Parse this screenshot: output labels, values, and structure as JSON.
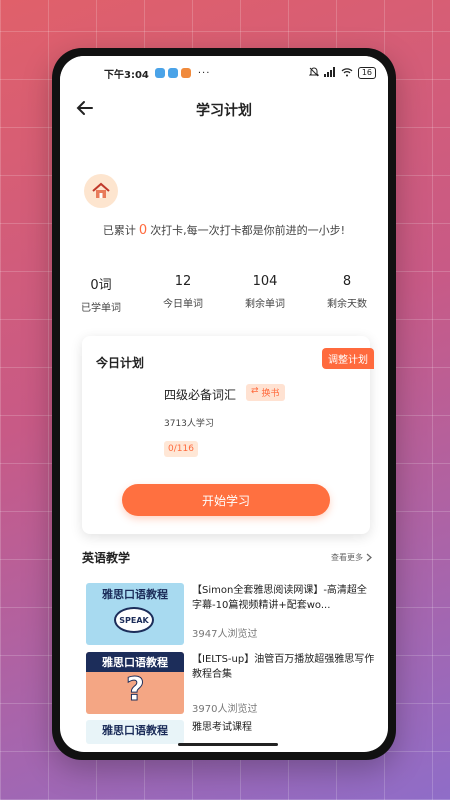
{
  "status_bar": {
    "time": "下午3:04",
    "dots": "···",
    "battery": "16"
  },
  "header": {
    "title": "学习计划"
  },
  "checkin": {
    "prefix": "已累计",
    "count": "0",
    "suffix": "次打卡,每一次打卡都是你前进的一小步!"
  },
  "stats": [
    {
      "value": "0词",
      "label": "已学单词"
    },
    {
      "value": "12",
      "label": "今日单词"
    },
    {
      "value": "104",
      "label": "剩余单词"
    },
    {
      "value": "8",
      "label": "剩余天数"
    }
  ],
  "plan": {
    "title": "今日计划",
    "adjust_label": "调整计划",
    "book_name": "四级必备词汇",
    "swap_label": "换书",
    "learners": "3713人学习",
    "progress": "0/116",
    "start_label": "开始学习"
  },
  "section": {
    "title": "英语教学",
    "see_more": "查看更多"
  },
  "courses": [
    {
      "title": "【Simon全套雅思阅读网课】-高清超全字幕-10篇视频精讲+配套wo...",
      "views": "3947人浏览过",
      "thumb_banner": "雅思口语教程",
      "thumb_badge": "SPEAK"
    },
    {
      "title": "【IELTS-up】油管百万播放超强雅思写作教程合集",
      "views": "3970人浏览过",
      "thumb_banner": "雅思口语教程",
      "thumb_badge": "?"
    },
    {
      "title": "雅思考试课程",
      "views": "",
      "thumb_banner": "雅思口语教程"
    }
  ],
  "colors": {
    "accent": "#ff6a3d",
    "text": "#222222"
  }
}
